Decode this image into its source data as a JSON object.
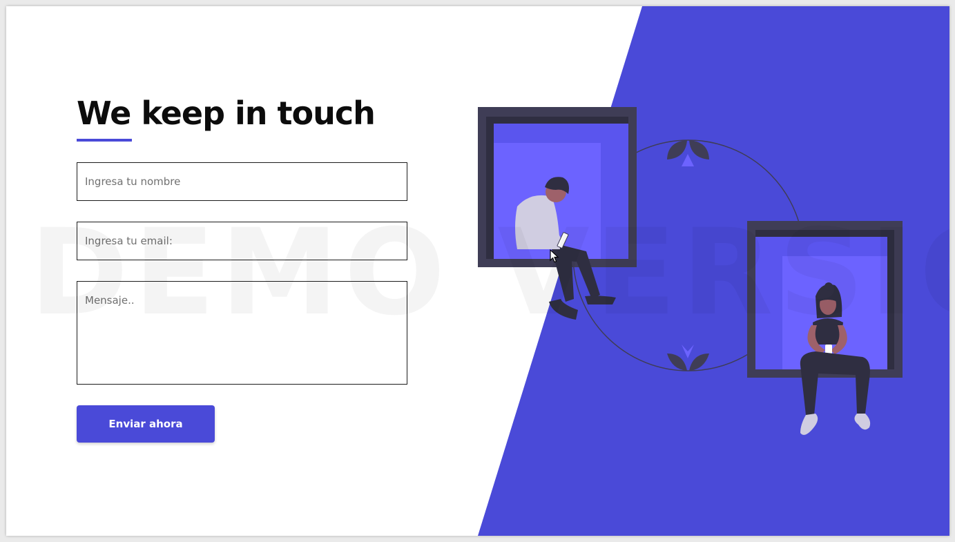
{
  "colors": {
    "accent": "#4a4ad8",
    "panel": "#4a4ad8",
    "window_frame": "#3f3d56",
    "window_glass": "#6c63ff"
  },
  "contact": {
    "title": "We keep in touch",
    "name_placeholder": "Ingresa tu nombre",
    "email_placeholder": "Ingresa tu email:",
    "message_placeholder": "Mensaje..",
    "submit_label": "Enviar ahora"
  },
  "watermark": "DEMO VERSION"
}
